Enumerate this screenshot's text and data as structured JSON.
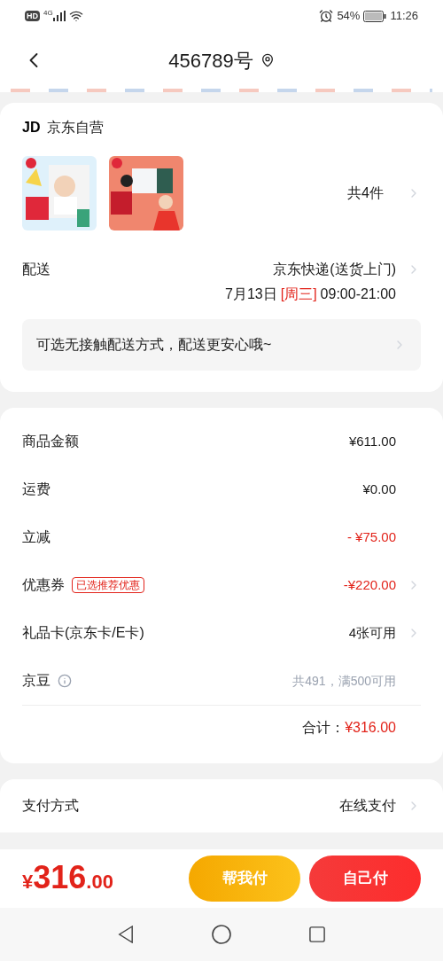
{
  "status_bar": {
    "badges": [
      "HD",
      "4G"
    ],
    "battery": "54%",
    "time": "11:26"
  },
  "header": {
    "title": "456789号"
  },
  "shop": {
    "logo": "JD",
    "name": "京东自营"
  },
  "products": {
    "count": "共4件"
  },
  "delivery": {
    "label": "配送",
    "method": "京东快递(送货上门)",
    "date": "7月13日",
    "weekday": "[周三]",
    "time": "09:00-21:00"
  },
  "notice": "可选无接触配送方式，配送更安心哦~",
  "summary": {
    "rows": [
      {
        "kind": "amount",
        "label": "商品金额",
        "value": "¥611.00"
      },
      {
        "kind": "amount",
        "label": "运费",
        "value": "¥0.00"
      },
      {
        "kind": "deduction",
        "label": "立减",
        "value": "- ¥75.00"
      },
      {
        "kind": "coupon",
        "label": "优惠券",
        "tag": "已选推荐优惠",
        "value": "-¥220.00"
      },
      {
        "kind": "card",
        "label": "礼品卡(京东卡/E卡)",
        "value": "4张可用"
      },
      {
        "kind": "beans",
        "label": "京豆",
        "value": "共491，满500可用"
      }
    ],
    "total": {
      "label": "合计：",
      "value": "¥316.00"
    }
  },
  "payment": {
    "label": "支付方式",
    "value": "在线支付"
  },
  "footer": {
    "currency": "¥",
    "integer": "316",
    "decimals": ".00",
    "buttons": [
      "帮我付",
      "自己付"
    ]
  }
}
